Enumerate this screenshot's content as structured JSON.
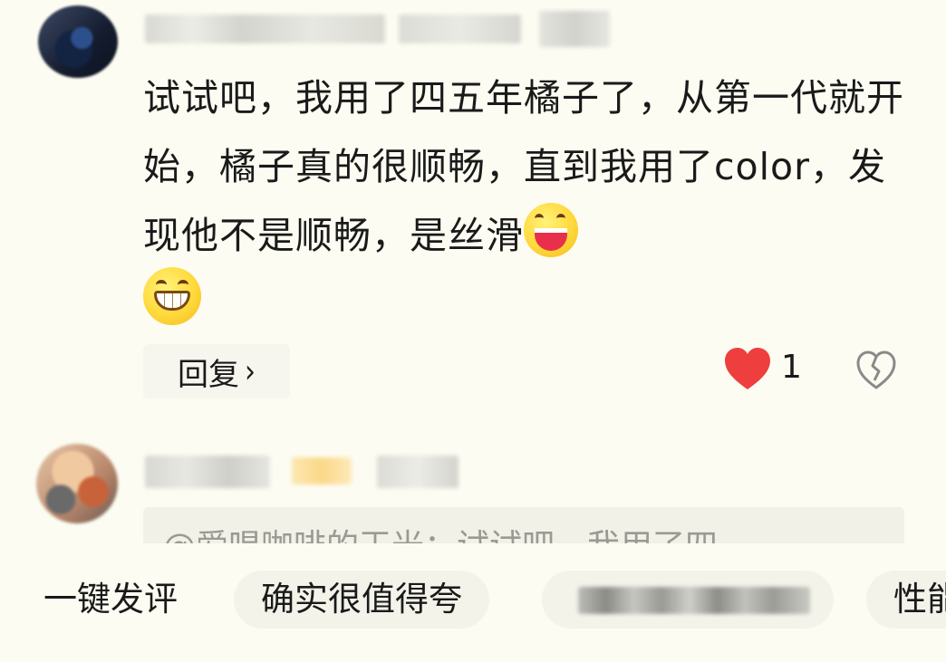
{
  "comment_1": {
    "text": "试试吧，我用了四五年橘子了，从第一代就开始，橘子真的很顺畅，直到我用了color，发现他不是顺畅，是丝滑",
    "emojis": [
      "laughing-emoji",
      "grinning-emoji"
    ],
    "reply_label": "回复",
    "reply_chevron": "›",
    "like_count": "1",
    "like_color": "#ef3e3e"
  },
  "comment_2": {
    "quote_text": "@爱唱咖啡的王光：试试吧，我用了四"
  },
  "quick_replies": {
    "label": "一键发评",
    "chip_1": "确实很值得夸",
    "chip_3": "性能"
  }
}
